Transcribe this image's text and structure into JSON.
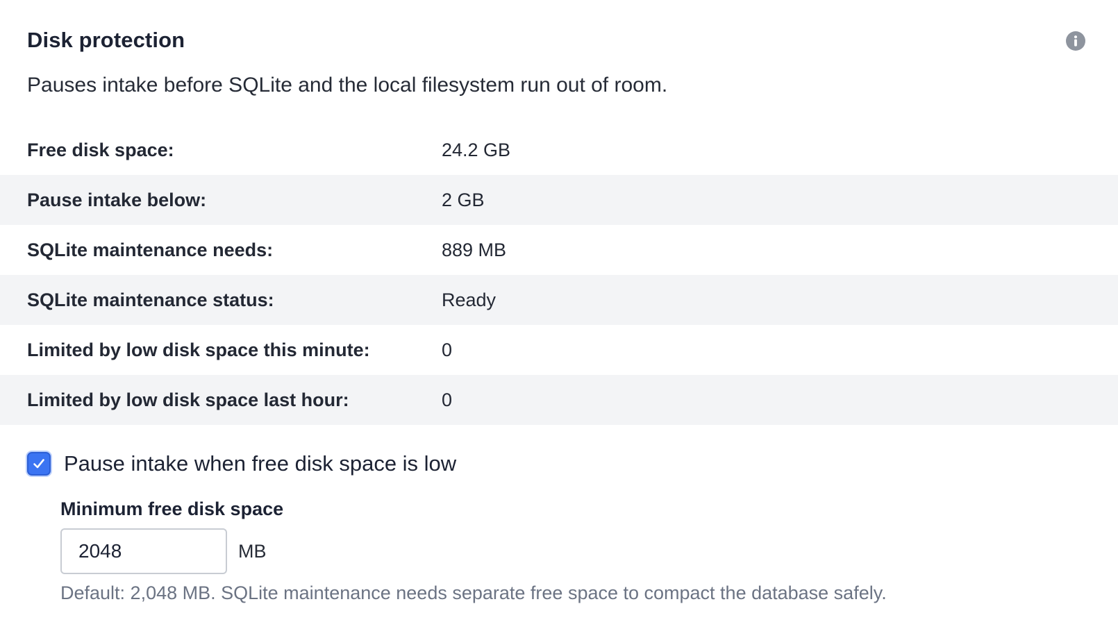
{
  "header": {
    "title": "Disk protection",
    "info_icon": "info-icon",
    "description": "Pauses intake before SQLite and the local filesystem run out of room."
  },
  "stats": [
    {
      "label": "Free disk space:",
      "value": "24.2 GB"
    },
    {
      "label": "Pause intake below:",
      "value": "2 GB"
    },
    {
      "label": "SQLite maintenance needs:",
      "value": "889 MB"
    },
    {
      "label": "SQLite maintenance status:",
      "value": "Ready"
    },
    {
      "label": "Limited by low disk space this minute:",
      "value": "0"
    },
    {
      "label": "Limited by low disk space last hour:",
      "value": "0"
    }
  ],
  "pause_setting": {
    "checked": true,
    "label": "Pause intake when free disk space is low"
  },
  "min_free": {
    "label": "Minimum free disk space",
    "value": "2048",
    "unit": "MB",
    "help": "Default: 2,048 MB. SQLite maintenance needs separate free space to compact the database safely."
  },
  "colors": {
    "accent": "#3b74f2",
    "row_alt": "#f3f4f6",
    "help_text": "#6b7383",
    "info_icon": "#8e949e"
  }
}
